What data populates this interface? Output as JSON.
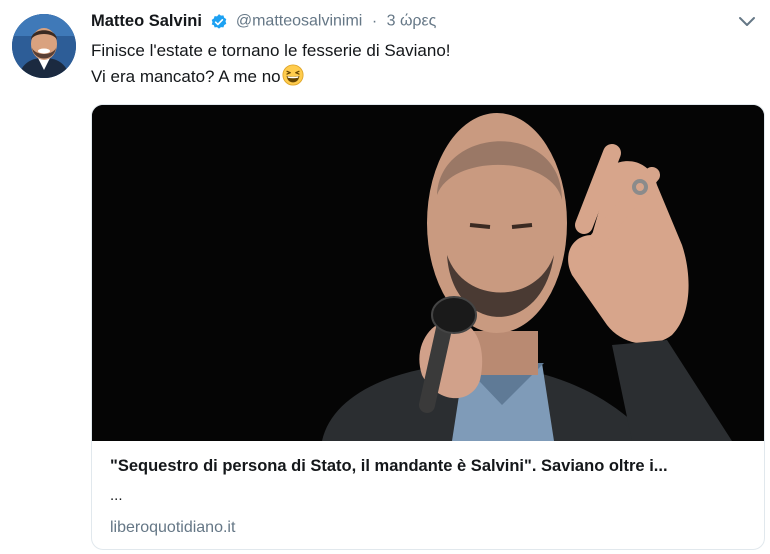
{
  "tweet": {
    "author_name": "Matteo Salvini",
    "handle": "@matteosalvinimi",
    "separator": "·",
    "time": "3 ώρες",
    "line1": "Finisce l'estate e tornano le fesserie di Saviano!",
    "line2": "Vi era mancato? A me no",
    "emoji": "grinning-squinting-face-icon"
  },
  "card": {
    "title": "\"Sequestro di persona di Stato, il mandante è Salvini\". Saviano oltre i...",
    "description": "...",
    "domain": "liberoquotidiano.it"
  },
  "colors": {
    "verified": "#1da1f2",
    "secondary_text": "#657786",
    "border": "#e1e8ed",
    "image_background": "#050505"
  }
}
